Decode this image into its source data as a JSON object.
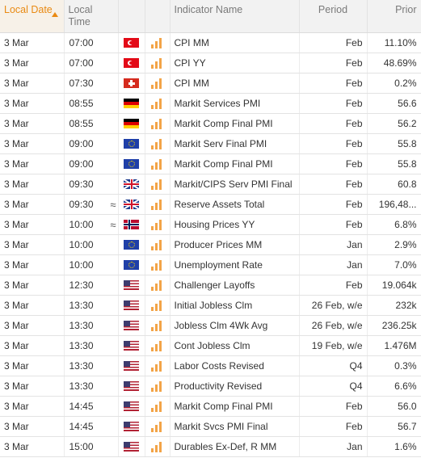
{
  "columns": {
    "local_date": "Local Date",
    "local_time": "Local Time",
    "indicator_name": "Indicator Name",
    "period": "Period",
    "prior": "Prior"
  },
  "colors": {
    "accent": "#e98a13",
    "importance_bars": "#f3a447",
    "header_bg": "#f2f2f2"
  },
  "rows": [
    {
      "date": "3 Mar",
      "time": "07:00",
      "wave": "",
      "flag": "turkey-flag",
      "name": "CPI MM",
      "period": "Feb",
      "prior": "11.10%"
    },
    {
      "date": "3 Mar",
      "time": "07:00",
      "wave": "",
      "flag": "turkey-flag",
      "name": "CPI YY",
      "period": "Feb",
      "prior": "48.69%"
    },
    {
      "date": "3 Mar",
      "time": "07:30",
      "wave": "",
      "flag": "switzerland-flag",
      "name": "CPI MM",
      "period": "Feb",
      "prior": "0.2%"
    },
    {
      "date": "3 Mar",
      "time": "08:55",
      "wave": "",
      "flag": "germany-flag",
      "name": "Markit Services PMI",
      "period": "Feb",
      "prior": "56.6"
    },
    {
      "date": "3 Mar",
      "time": "08:55",
      "wave": "",
      "flag": "germany-flag",
      "name": "Markit Comp Final PMI",
      "period": "Feb",
      "prior": "56.2"
    },
    {
      "date": "3 Mar",
      "time": "09:00",
      "wave": "",
      "flag": "eu-flag",
      "name": "Markit Serv Final PMI",
      "period": "Feb",
      "prior": "55.8"
    },
    {
      "date": "3 Mar",
      "time": "09:00",
      "wave": "",
      "flag": "eu-flag",
      "name": "Markit Comp Final PMI",
      "period": "Feb",
      "prior": "55.8"
    },
    {
      "date": "3 Mar",
      "time": "09:30",
      "wave": "",
      "flag": "uk-flag",
      "name": "Markit/CIPS Serv PMI Final",
      "period": "Feb",
      "prior": "60.8"
    },
    {
      "date": "3 Mar",
      "time": "09:30",
      "wave": "≈",
      "flag": "uk-flag",
      "name": "Reserve Assets Total",
      "period": "Feb",
      "prior": "196,48..."
    },
    {
      "date": "3 Mar",
      "time": "10:00",
      "wave": "≈",
      "flag": "norway-flag",
      "name": "Housing Prices YY",
      "period": "Feb",
      "prior": "6.8%"
    },
    {
      "date": "3 Mar",
      "time": "10:00",
      "wave": "",
      "flag": "eu-flag",
      "name": "Producer Prices MM",
      "period": "Jan",
      "prior": "2.9%"
    },
    {
      "date": "3 Mar",
      "time": "10:00",
      "wave": "",
      "flag": "eu-flag",
      "name": "Unemployment Rate",
      "period": "Jan",
      "prior": "7.0%"
    },
    {
      "date": "3 Mar",
      "time": "12:30",
      "wave": "",
      "flag": "us-flag",
      "name": "Challenger Layoffs",
      "period": "Feb",
      "prior": "19.064k"
    },
    {
      "date": "3 Mar",
      "time": "13:30",
      "wave": "",
      "flag": "us-flag",
      "name": "Initial Jobless Clm",
      "period": "26 Feb, w/e",
      "prior": "232k"
    },
    {
      "date": "3 Mar",
      "time": "13:30",
      "wave": "",
      "flag": "us-flag",
      "name": "Jobless Clm 4Wk Avg",
      "period": "26 Feb, w/e",
      "prior": "236.25k"
    },
    {
      "date": "3 Mar",
      "time": "13:30",
      "wave": "",
      "flag": "us-flag",
      "name": "Cont Jobless Clm",
      "period": "19 Feb, w/e",
      "prior": "1.476M"
    },
    {
      "date": "3 Mar",
      "time": "13:30",
      "wave": "",
      "flag": "us-flag",
      "name": "Labor Costs Revised",
      "period": "Q4",
      "prior": "0.3%"
    },
    {
      "date": "3 Mar",
      "time": "13:30",
      "wave": "",
      "flag": "us-flag",
      "name": "Productivity Revised",
      "period": "Q4",
      "prior": "6.6%"
    },
    {
      "date": "3 Mar",
      "time": "14:45",
      "wave": "",
      "flag": "us-flag",
      "name": "Markit Comp Final PMI",
      "period": "Feb",
      "prior": "56.0"
    },
    {
      "date": "3 Mar",
      "time": "14:45",
      "wave": "",
      "flag": "us-flag",
      "name": "Markit Svcs PMI Final",
      "period": "Feb",
      "prior": "56.7"
    },
    {
      "date": "3 Mar",
      "time": "15:00",
      "wave": "",
      "flag": "us-flag",
      "name": "Durables Ex-Def, R MM",
      "period": "Jan",
      "prior": "1.6%"
    }
  ]
}
